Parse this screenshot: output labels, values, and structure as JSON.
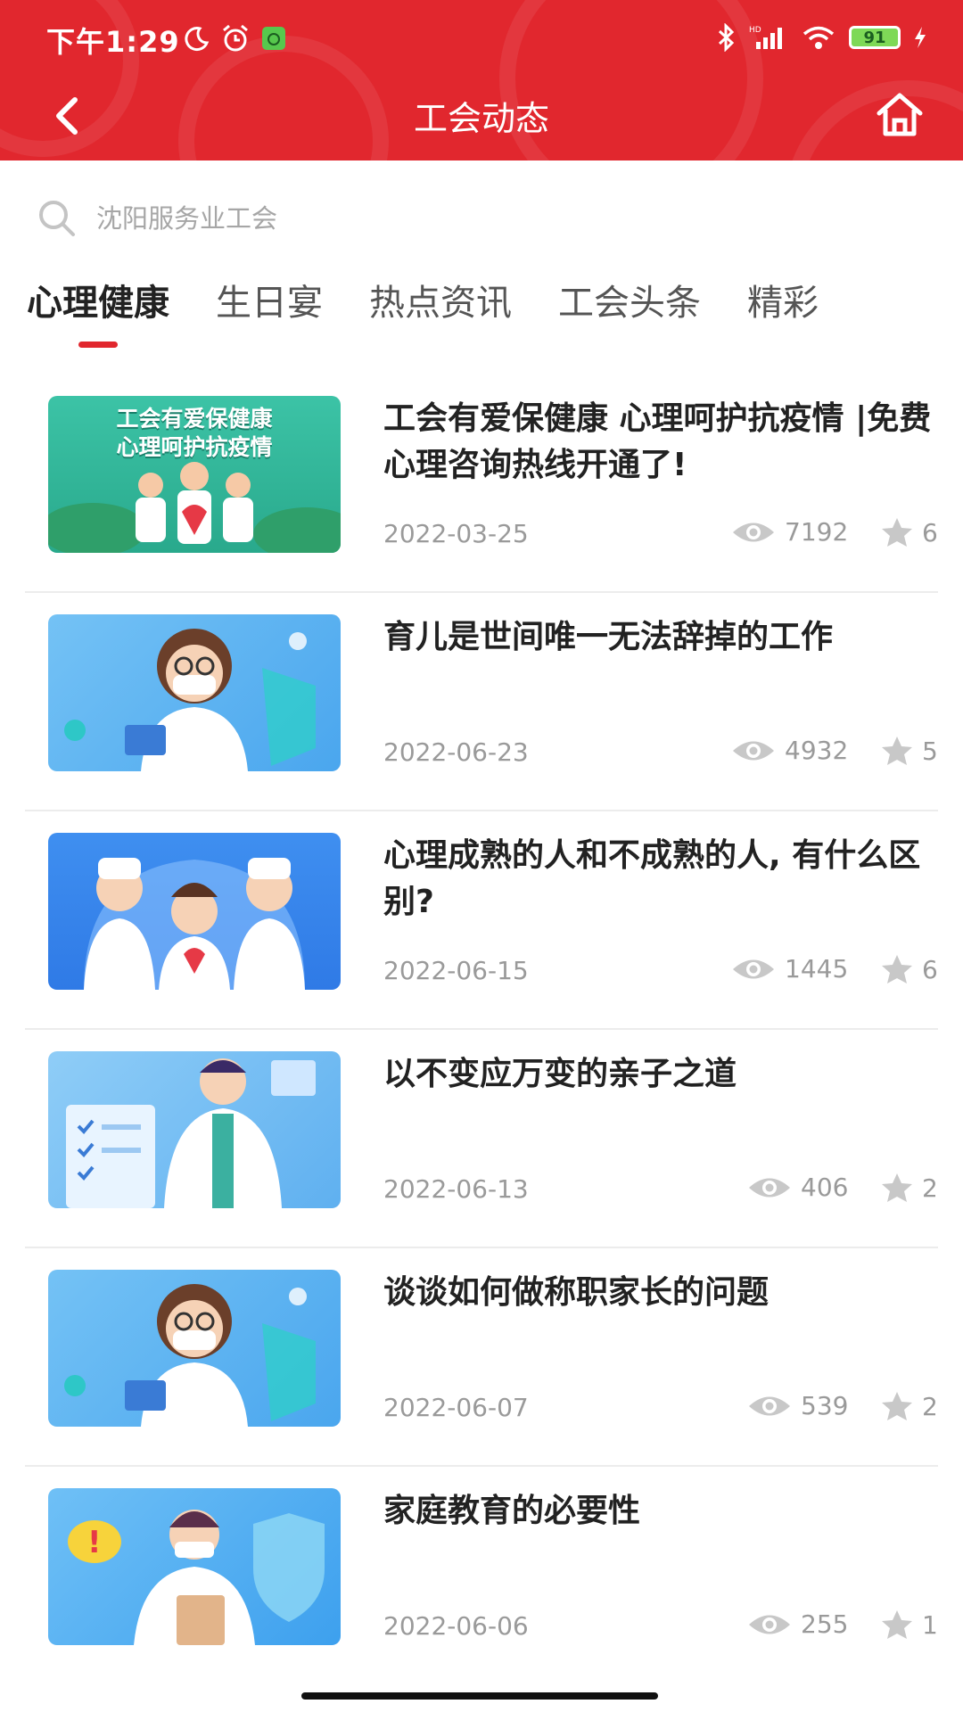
{
  "status": {
    "time": "下午1:29",
    "battery": "91"
  },
  "nav": {
    "title": "工会动态",
    "back_icon": "chevron-left-icon",
    "home_icon": "home-icon"
  },
  "search": {
    "placeholder": "沈阳服务业工会"
  },
  "tabs": [
    {
      "label": "心理健康",
      "active": true
    },
    {
      "label": "生日宴"
    },
    {
      "label": "热点资讯"
    },
    {
      "label": "工会头条"
    },
    {
      "label": "精彩"
    }
  ],
  "articles": [
    {
      "title": "工会有爱保健康 心理呵护抗疫情 |免费心理咨询热线开通了!",
      "thumb_text": [
        "工会有爱保健康",
        "心理呵护抗疫情"
      ],
      "date": "2022-03-25",
      "views": "7192",
      "stars": "6"
    },
    {
      "title": "育儿是世间唯一无法辞掉的工作",
      "date": "2022-06-23",
      "views": "4932",
      "stars": "5"
    },
    {
      "title": "心理成熟的人和不成熟的人, 有什么区别?",
      "date": "2022-06-15",
      "views": "1445",
      "stars": "6"
    },
    {
      "title": "以不变应万变的亲子之道",
      "date": "2022-06-13",
      "views": "406",
      "stars": "2"
    },
    {
      "title": "谈谈如何做称职家长的问题",
      "date": "2022-06-07",
      "views": "539",
      "stars": "2"
    },
    {
      "title": "家庭教育的必要性",
      "date": "2022-06-06",
      "views": "255",
      "stars": "1"
    }
  ],
  "colors": {
    "brand_red": "#e1272e",
    "meta_gray": "#9a9a9a"
  }
}
